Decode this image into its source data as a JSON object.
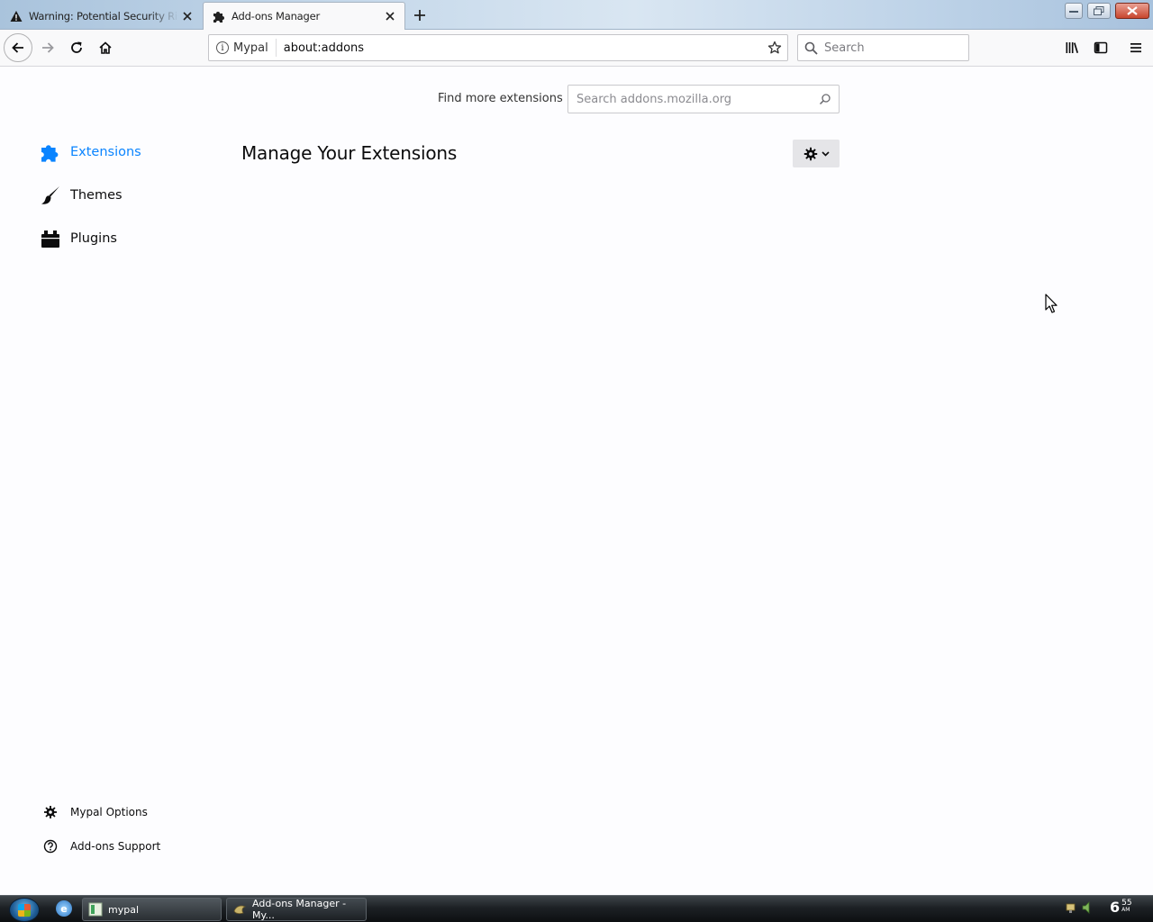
{
  "tabs": [
    {
      "label": "Warning: Potential Security Risk Ahead",
      "icon": "warning-icon",
      "active": false
    },
    {
      "label": "Add-ons Manager",
      "icon": "puzzle-icon",
      "active": true
    }
  ],
  "navbar": {
    "identity_label": "Mypal",
    "url": "about:addons",
    "search_placeholder": "Search"
  },
  "content": {
    "find_more_label": "Find more extensions",
    "amo_search_placeholder": "Search addons.mozilla.org",
    "heading": "Manage Your Extensions"
  },
  "categories": [
    {
      "label": "Extensions",
      "icon": "puzzle-icon",
      "selected": true
    },
    {
      "label": "Themes",
      "icon": "brush-icon",
      "selected": false
    },
    {
      "label": "Plugins",
      "icon": "plugin-icon",
      "selected": false
    }
  ],
  "footer_links": [
    {
      "label": "Mypal Options",
      "icon": "gear-icon"
    },
    {
      "label": "Add-ons Support",
      "icon": "help-icon"
    }
  ],
  "taskbar": {
    "buttons": [
      {
        "label": "mypal"
      },
      {
        "label": "Add-ons Manager - My..."
      }
    ],
    "clock_hour": "6",
    "clock_minute": "55",
    "clock_ampm": "AM"
  },
  "colors": {
    "accent": "#0a84ff",
    "page_background": "#fdfdff",
    "toolbar": "#f9f9fa"
  }
}
